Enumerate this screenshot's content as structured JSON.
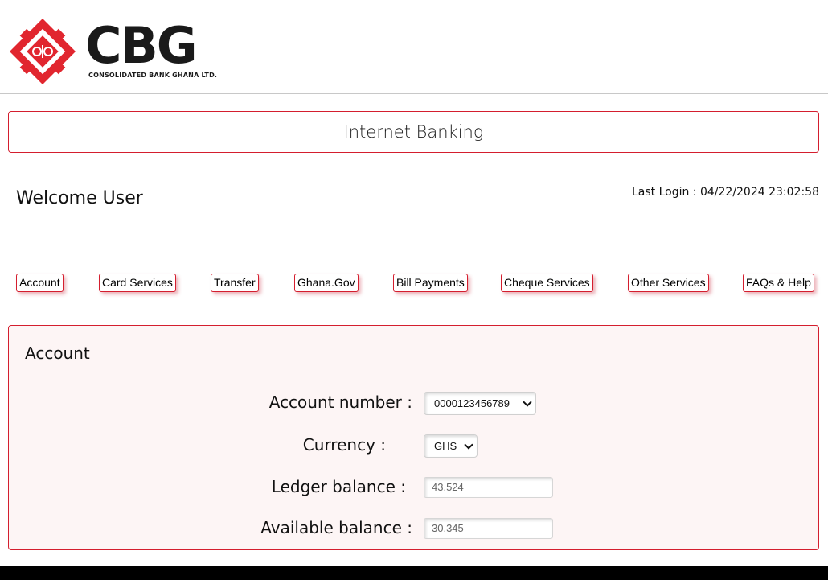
{
  "brand": {
    "logo_text": "CBG",
    "logo_subtext": "CONSOLIDATED BANK GHANA LTD.",
    "accent_color": "#d41e2e"
  },
  "header": {
    "title": "Internet Banking"
  },
  "welcome": {
    "greeting": "Welcome User",
    "last_login": "Last Login : 04/22/2024 23:02:58"
  },
  "nav": {
    "items": [
      {
        "label": "Account"
      },
      {
        "label": "Card Services"
      },
      {
        "label": "Transfer"
      },
      {
        "label": "Ghana.Gov"
      },
      {
        "label": "Bill Payments"
      },
      {
        "label": "Cheque Services"
      },
      {
        "label": "Other Services"
      },
      {
        "label": "FAQs & Help"
      }
    ]
  },
  "account": {
    "title": "Account",
    "account_number": {
      "label": "Account number :",
      "value": "0000123456789"
    },
    "currency": {
      "label": "Currency :",
      "value": "GHS"
    },
    "ledger_balance": {
      "label": "Ledger balance :",
      "value": "43,524"
    },
    "available_balance": {
      "label": "Available balance :",
      "value": "30,345"
    }
  }
}
